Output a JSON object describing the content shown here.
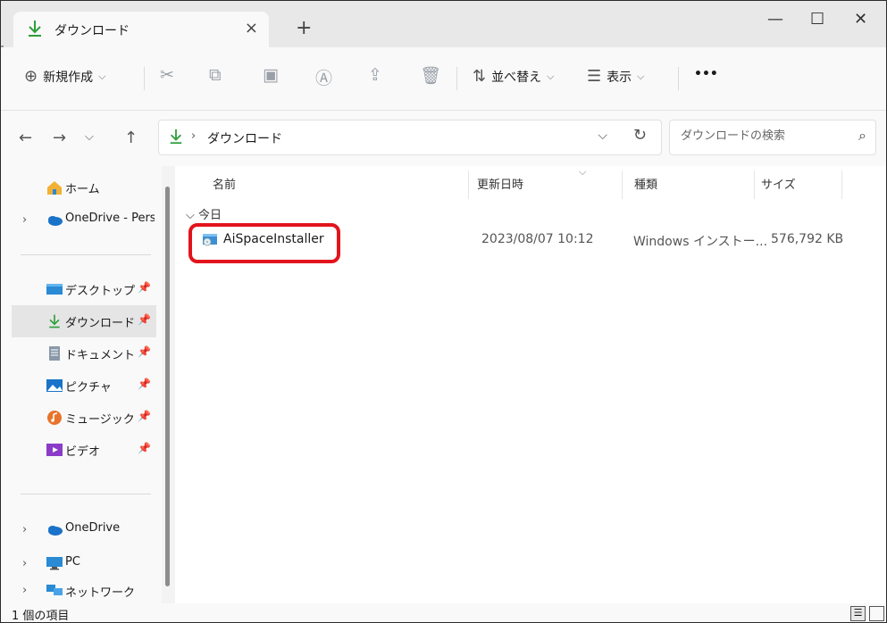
{
  "window": {
    "tab_title": "ダウンロード",
    "tab_close": "×",
    "new_tab": "+",
    "minimize": "—",
    "maximize": "☐",
    "close": "✕"
  },
  "toolbar": {
    "new_label": "新規作成",
    "sort_label": "並べ替え",
    "view_label": "表示",
    "more_label": "•••"
  },
  "address": {
    "crumb": "ダウンロード",
    "search_placeholder": "ダウンロードの検索"
  },
  "sidebar": {
    "items": [
      {
        "label": "ホーム",
        "icon": "home-icon"
      },
      {
        "label": "OneDrive - Perso",
        "icon": "cloud-icon"
      },
      {
        "label": "デスクトップ",
        "icon": "desktop-icon"
      },
      {
        "label": "ダウンロード",
        "icon": "download-icon"
      },
      {
        "label": "ドキュメント",
        "icon": "document-icon"
      },
      {
        "label": "ピクチャ",
        "icon": "pictures-icon"
      },
      {
        "label": "ミュージック",
        "icon": "music-icon"
      },
      {
        "label": "ビデオ",
        "icon": "video-icon"
      },
      {
        "label": "OneDrive",
        "icon": "cloud-icon"
      },
      {
        "label": "PC",
        "icon": "pc-icon"
      },
      {
        "label": "ネットワーク",
        "icon": "network-icon"
      }
    ]
  },
  "columns": {
    "name": "名前",
    "date": "更新日時",
    "type": "種類",
    "size": "サイズ"
  },
  "group": {
    "label": "今日"
  },
  "files": [
    {
      "name": "AiSpaceInstaller",
      "date": "2023/08/07 10:12",
      "type": "Windows インストー...",
      "size": "576,792 KB",
      "icon": "installer-icon"
    }
  ],
  "status": {
    "item_count": "1 個の項目"
  },
  "colors": {
    "highlight": "#e2141c",
    "accent": "#0f7bd8",
    "download_green": "#2e9e3a"
  }
}
